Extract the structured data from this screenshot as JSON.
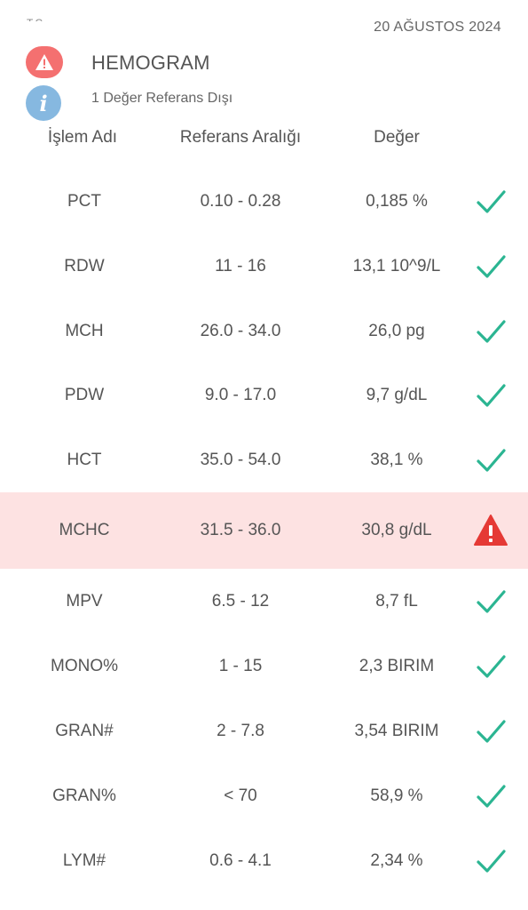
{
  "header": {
    "cutoff_text": "T.C.",
    "date": "20 AĞUSTOS 2024",
    "title": "HEMOGRAM",
    "subtitle": "1 Değer Referans Dışı"
  },
  "columns": {
    "name": "İşlem Adı",
    "range": "Referans Aralığı",
    "value": "Değer"
  },
  "colors": {
    "check": "#2bb592",
    "alert_bg": "#fde2e2",
    "alert_icon": "#e53935",
    "warn_badge": "#f47070",
    "info_badge": "#86b8e0"
  },
  "rows": [
    {
      "name": "PCT",
      "range": "0.10 - 0.28",
      "value": "0,185 %",
      "status": "check-icon"
    },
    {
      "name": "RDW",
      "range": "11 - 16",
      "value": "13,1 10^9/L",
      "status": "check-icon"
    },
    {
      "name": "MCH",
      "range": "26.0 - 34.0",
      "value": "26,0 pg",
      "status": "check-icon"
    },
    {
      "name": "PDW",
      "range": "9.0 - 17.0",
      "value": "9,7 g/dL",
      "status": "check-icon"
    },
    {
      "name": "HCT",
      "range": "35.0 - 54.0",
      "value": "38,1 %",
      "status": "check-icon"
    },
    {
      "name": "MCHC",
      "range": "31.5 - 36.0",
      "value": "30,8 g/dL",
      "status": "warning-icon"
    },
    {
      "name": "MPV",
      "range": "6.5 - 12",
      "value": "8,7 fL",
      "status": "check-icon"
    },
    {
      "name": "MONO%",
      "range": "1 - 15",
      "value": "2,3 BIRIM",
      "status": "check-icon"
    },
    {
      "name": "GRAN#",
      "range": "2 - 7.8",
      "value": "3,54 BIRIM",
      "status": "check-icon"
    },
    {
      "name": "GRAN%",
      "range": "< 70",
      "value": "58,9 %",
      "status": "check-icon"
    },
    {
      "name": "LYM#",
      "range": "0.6 - 4.1",
      "value": "2,34 %",
      "status": "check-icon"
    }
  ]
}
